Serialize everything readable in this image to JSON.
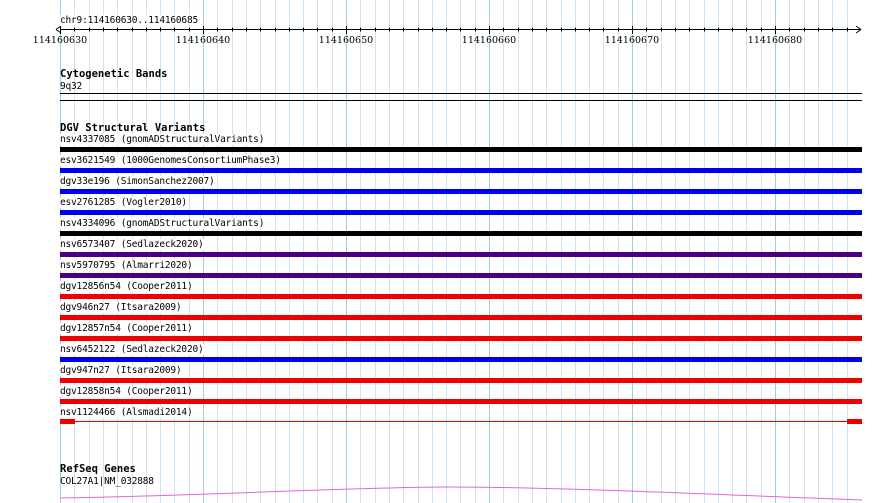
{
  "ruler": {
    "region": "chr9:114160630..114160685",
    "ticks": [
      "114160630",
      "114160640",
      "114160650",
      "114160660",
      "114160670",
      "114160680"
    ]
  },
  "cytogenetic": {
    "title": "Cytogenetic Bands",
    "band": "9q32"
  },
  "dgv": {
    "title": "DGV Structural Variants",
    "variants": [
      {
        "label": "nsv4337085 (gnomADStructuralVariants)",
        "color": "#000000"
      },
      {
        "label": "esv3621549 (1000GenomesConsortiumPhase3)",
        "color": "#0000ee"
      },
      {
        "label": "dgv33e196 (SimonSanchez2007)",
        "color": "#0000ee"
      },
      {
        "label": "esv2761285 (Vogler2010)",
        "color": "#0000ee"
      },
      {
        "label": "nsv4334096 (gnomADStructuralVariants)",
        "color": "#000000"
      },
      {
        "label": "nsv6573407 (Sedlazeck2020)",
        "color": "#4b0082"
      },
      {
        "label": "nsv5970795 (Almarri2020)",
        "color": "#4b0082"
      },
      {
        "label": "dgv12856n54 (Cooper2011)",
        "color": "#ee0000"
      },
      {
        "label": "dgv946n27 (Itsara2009)",
        "color": "#ee0000"
      },
      {
        "label": "dgv12857n54 (Cooper2011)",
        "color": "#ee0000"
      },
      {
        "label": "nsv6452122 (Sedlazeck2020)",
        "color": "#0000ee"
      },
      {
        "label": "dgv947n27 (Itsara2009)",
        "color": "#ee0000"
      },
      {
        "label": "dgv12858n54 (Cooper2011)",
        "color": "#ee0000"
      },
      {
        "label": "nsv1124466 (Alsmadi2014)",
        "color": "#ee0000"
      }
    ]
  },
  "refseq": {
    "title": "RefSeq Genes",
    "gene": "COL27A1|NM_032888",
    "color": "#dd66dd"
  },
  "grid": {
    "major_color": "#9ccce6",
    "minor_color": "#cce4f2"
  }
}
